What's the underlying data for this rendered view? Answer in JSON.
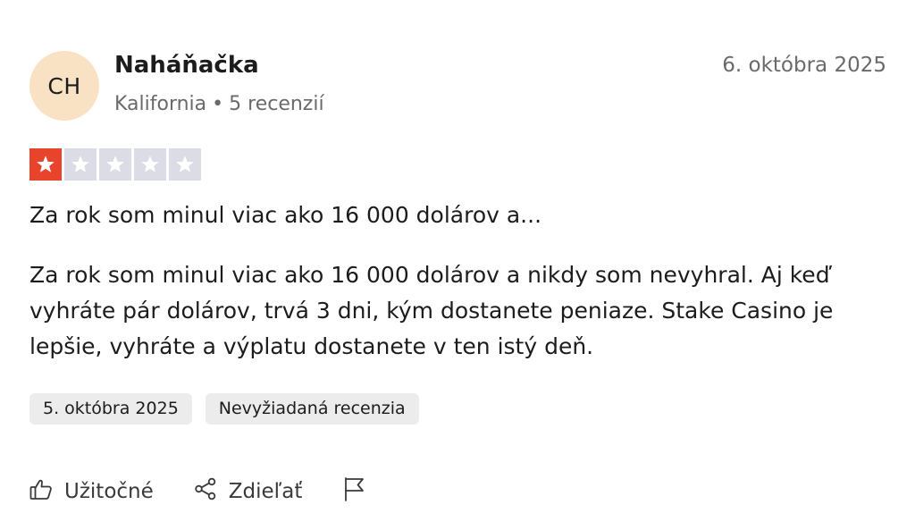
{
  "reviewer": {
    "initials": "CH",
    "avatar_color": "#f9e2c4",
    "name": "Naháňačka",
    "location": "Kalifornia",
    "separator": "•",
    "review_count": "5 recenzií"
  },
  "review": {
    "date": "6. októbra 2025",
    "rating": 1,
    "rating_max": 5,
    "star_filled_color": "#e8432b",
    "star_empty_color": "#dcdce6",
    "title": "Za rok som minul viac ako 16 000 dolárov a...",
    "body": "Za rok som minul viac ako 16 000 dolárov a nikdy som nevyhral. Aj keď vyhráte pár dolárov, trvá 3 dni, kým dostanete peniaze. Stake Casino je lepšie, vyhráte a výplatu dostanete v ten istý deň.",
    "tags": {
      "experience_date": "5. októbra 2025",
      "type": "Nevyžiadaná recenzia"
    }
  },
  "actions": {
    "useful_label": "Užitočné",
    "useful_icon": "thumbs-up-icon",
    "share_label": "Zdieľať",
    "share_icon": "share-icon",
    "report_icon": "flag-icon"
  }
}
